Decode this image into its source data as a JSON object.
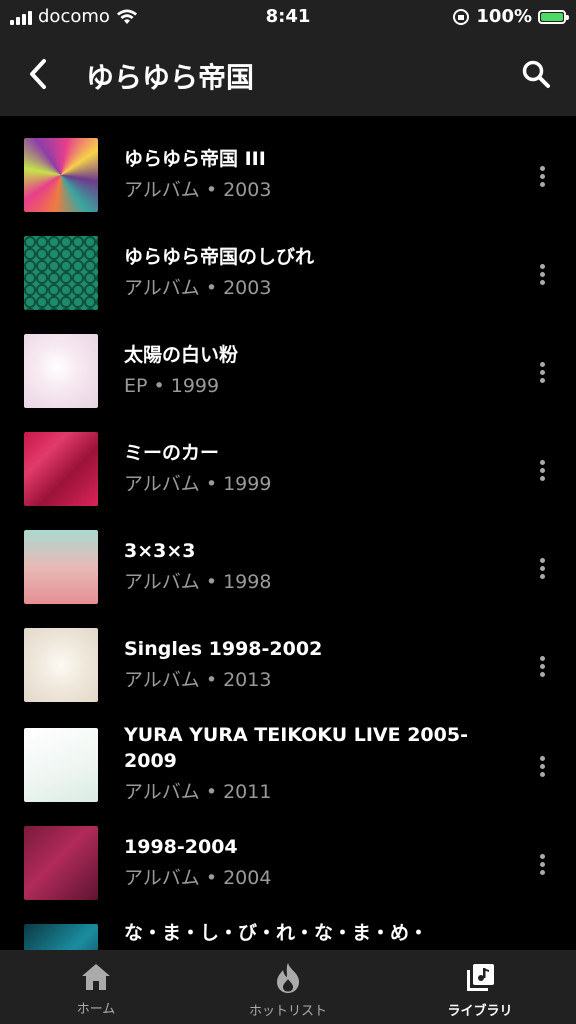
{
  "status": {
    "carrier": "docomo",
    "time": "8:41",
    "battery": "100%"
  },
  "header": {
    "title": "ゆらゆら帝国",
    "back_icon": "chevron-left-icon",
    "search_icon": "search-icon"
  },
  "albums": [
    {
      "title": "ゆらゆら帝国 III",
      "subtitle": "アルバム • 2003"
    },
    {
      "title": "ゆらゆら帝国のしびれ",
      "subtitle": "アルバム • 2003"
    },
    {
      "title": "太陽の白い粉",
      "subtitle": "EP • 1999"
    },
    {
      "title": "ミーのカー",
      "subtitle": "アルバム • 1999"
    },
    {
      "title": "3×3×3",
      "subtitle": "アルバム • 1998"
    },
    {
      "title": "Singles 1998-2002",
      "subtitle": "アルバム • 2013"
    },
    {
      "title": "YURA YURA TEIKOKU LIVE 2005-2009",
      "subtitle": "アルバム • 2011"
    },
    {
      "title": "1998-2004",
      "subtitle": "アルバム • 2004"
    },
    {
      "title": "な・ま・し・び・れ・な・ま・め・",
      "subtitle": ""
    }
  ],
  "nav": {
    "home": "ホーム",
    "hotlist": "ホットリスト",
    "library": "ライブラリ"
  },
  "colors": {
    "background": "#000000",
    "bar": "#212121",
    "secondary_text": "#9a9a9a",
    "battery": "#4cd964"
  }
}
